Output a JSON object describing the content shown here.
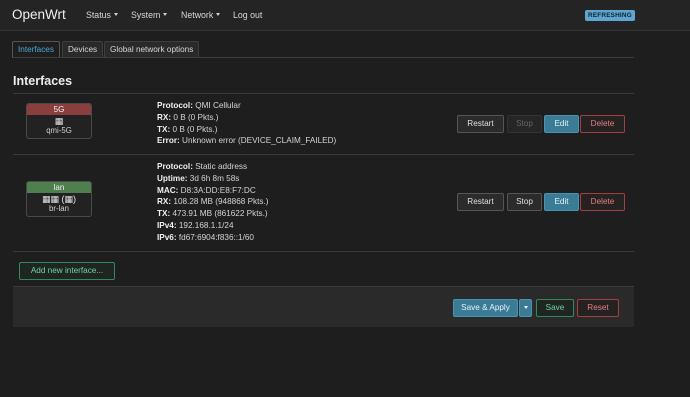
{
  "nav": {
    "brand": "OpenWrt",
    "menus": [
      "Status",
      "System",
      "Network",
      "Log out"
    ],
    "refresh_badge": "REFRESHING"
  },
  "tabs": [
    "Interfaces",
    "Devices",
    "Global network options"
  ],
  "section_title": "Interfaces",
  "interfaces": [
    {
      "name": "5G",
      "header_color": "#8a3e3e",
      "device": "qmi-5G",
      "icons": "▦",
      "fields": [
        {
          "label": "Protocol:",
          "value": "QMI Cellular"
        },
        {
          "label": "RX:",
          "value": "0 B (0 Pkts.)"
        },
        {
          "label": "TX:",
          "value": "0 B (0 Pkts.)"
        },
        {
          "label": "Error:",
          "value": "Unknown error (DEVICE_CLAIM_FAILED)"
        }
      ],
      "actions": [
        "Restart",
        "Stop",
        "Edit",
        "Delete"
      ],
      "stop_disabled": true
    },
    {
      "name": "lan",
      "header_color": "#4f7e4f",
      "device": "br-lan",
      "icons": "▦▦ (▦)",
      "fields": [
        {
          "label": "Protocol:",
          "value": "Static address"
        },
        {
          "label": "Uptime:",
          "value": "3d 6h 8m 58s"
        },
        {
          "label": "MAC:",
          "value": "D8:3A:DD:E8:F7:DC"
        },
        {
          "label": "RX:",
          "value": "108.28 MB (948868 Pkts.)"
        },
        {
          "label": "TX:",
          "value": "473.91 MB (861622 Pkts.)"
        },
        {
          "label": "IPv4:",
          "value": "192.168.1.1/24"
        },
        {
          "label": "IPv6:",
          "value": "fd67:6904:f836::1/60"
        }
      ],
      "actions": [
        "Restart",
        "Stop",
        "Edit",
        "Delete"
      ],
      "stop_disabled": false
    }
  ],
  "add_interface_label": "Add new interface...",
  "footer": {
    "save_apply": "Save & Apply",
    "save": "Save",
    "reset": "Reset"
  }
}
